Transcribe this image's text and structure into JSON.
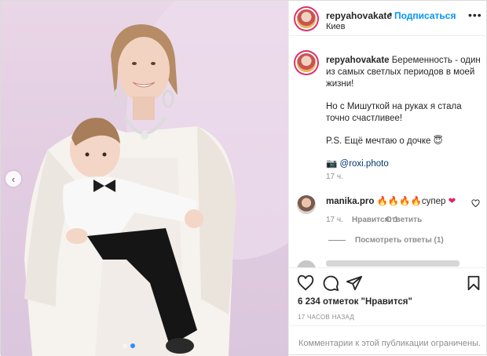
{
  "post": {
    "username": "repyahovakate",
    "location": "Киев",
    "follow_label": "Подписаться",
    "dot": "•",
    "more_icon": "more-horizontal-icon",
    "caption": {
      "line1": "Беременность - один из самых светлых периодов в моей жизни!",
      "line2": "Но с Мишуткой на руках я стала точно счастливее!",
      "line3": "P.S. Ещё мечтаю о дочке",
      "line3_emoji": "😇",
      "camera_emoji": "📷",
      "photo_credit": "@roxi.photo",
      "time": "17 ч."
    },
    "comments": [
      {
        "username": "manika.pro",
        "text": "🔥🔥🔥🔥супер",
        "heart": "❤",
        "time": "17 ч.",
        "like_label": "Нравится: 1",
        "reply_label": "Ответить"
      }
    ],
    "view_replies": "Посмотреть ответы (1)",
    "likes": "6 234 отметок \"Нравится\"",
    "posted_ago": "17 часов назад",
    "comments_limited": "Комментарии к этой публикации ограничены."
  },
  "colors": {
    "accent_blue": "#0095f6",
    "story_ring": "#e1306c",
    "secondary_text": "#8e8e8e",
    "carousel_active": "#2f8cff"
  },
  "carousel": {
    "count": 2,
    "active": 1
  }
}
